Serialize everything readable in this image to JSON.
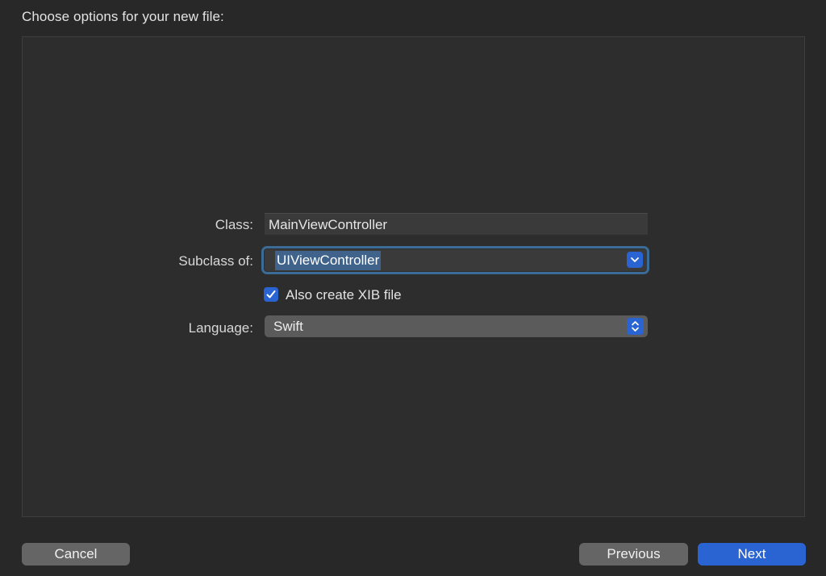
{
  "header": {
    "title": "Choose options for your new file:"
  },
  "form": {
    "class_label": "Class:",
    "class_value": "MainViewController",
    "subclass_label": "Subclass of:",
    "subclass_value": "UIViewController",
    "checkbox_label": "Also create XIB file",
    "checkbox_checked": true,
    "language_label": "Language:",
    "language_value": "Swift"
  },
  "footer": {
    "cancel_label": "Cancel",
    "previous_label": "Previous",
    "next_label": "Next"
  },
  "icons": {
    "combo_arrow": "chevron-down-icon",
    "popup_arrows": "up-down-chevron-icon",
    "checkbox": "checkmark-icon"
  },
  "colors": {
    "accent": "#2a64d3",
    "background": "#282828",
    "panel": "#2d2d2d",
    "focus_ring": "#3b6b97",
    "selection": "#3f638b"
  }
}
